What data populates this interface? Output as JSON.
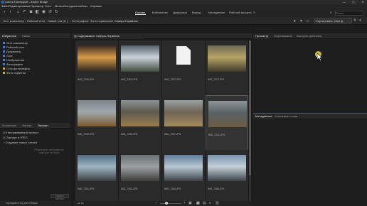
{
  "window": {
    "title": "Спена Гриппирай - Adobe Bridge",
    "minimize": "—",
    "maximize": "▢",
    "close": "✕"
  },
  "menu": [
    "Файл",
    "Редактирование",
    "Просмотр",
    "Стек",
    "Метки",
    "Инструменты",
    "Окно",
    "Справка"
  ],
  "workspaces": [
    {
      "label": "Основн.",
      "active": true
    },
    {
      "label": "Библиотеки",
      "active": false
    },
    {
      "label": "Диафильм",
      "active": false
    },
    {
      "label": "Вывод",
      "active": false
    },
    {
      "label": "Метаданные",
      "active": false
    },
    {
      "label": "Рабочий процесс",
      "active": false
    }
  ],
  "search_placeholder": "Поиск",
  "breadcrumbs": [
    "Этот компьютер",
    "Рабочий стол",
    "Новый том (D:)",
    "Фотографии",
    "Фото норвежские",
    "Северо-Норвегия"
  ],
  "sort": {
    "label": "Сортировать: Имя ф.",
    "menu": "▾"
  },
  "left_panel": {
    "tabs": [
      "Избранное",
      "Папки"
    ],
    "favorites": [
      {
        "label": "Этот компьютер",
        "color": "#4a79c6"
      },
      {
        "label": "Рабочий стол",
        "color": "#4a79c6"
      },
      {
        "label": "Документы",
        "color": "#4a79c6"
      },
      {
        "label": "Cont",
        "color": "#4a79c6"
      },
      {
        "label": "Изображения",
        "color": "#4a79c6"
      },
      {
        "label": "Фотографии",
        "color": "#4a79c6"
      },
      {
        "label": "Сток фотографии",
        "color": "#c9a84a"
      },
      {
        "label": "Фото норвегии",
        "color": "#c9a84a"
      }
    ],
    "lower_tabs": [
      "Коллекции",
      "Фильтр",
      "Экспорт"
    ],
    "export_items": [
      "Настраиваемый экспорт",
      "Экспорт в JPEG",
      "Создание новых стилей"
    ],
    "drop_hint": "Перетащите изображения сюда для экспорта",
    "start_button": "Начать экспорт"
  },
  "content": {
    "tab": "Содержимое: Северо-Норвегия",
    "items": [
      {
        "name": "IMG_7196.JPG",
        "kind": "photo",
        "palette": [
          "#3a2a24",
          "#d79a48",
          "#2b2620"
        ]
      },
      {
        "name": "IMG_7203.JPG",
        "kind": "photo",
        "palette": [
          "#55606a",
          "#c9d2d8",
          "#3f4b3e"
        ]
      },
      {
        "name": "IMG_7207.JPG",
        "kind": "file",
        "palette": [
          "#f2f2f2",
          "#ffffff",
          "#d0d0d0"
        ]
      },
      {
        "name": "IMG_7212.JPG",
        "kind": "photo",
        "palette": [
          "#6d6a55",
          "#b7a465",
          "#3e3b2b"
        ]
      },
      {
        "name": "IMG_7230.JPG",
        "kind": "photo",
        "palette": [
          "#7d858a",
          "#a0a8ad",
          "#7a5a2e"
        ]
      },
      {
        "name": "IMG_7233.JPG",
        "kind": "photo",
        "palette": [
          "#8b9296",
          "#5e5a4d",
          "#9b7d4e"
        ]
      },
      {
        "name": "IMG_7237.JPG",
        "kind": "photo",
        "palette": [
          "#9aa3a6",
          "#6f6456",
          "#a48a5a"
        ]
      },
      {
        "name": "IMG_7241.JPG",
        "kind": "photo",
        "palette": [
          "#8e969a",
          "#596266",
          "#6b5b42"
        ]
      },
      {
        "name": "IMG_7251.JPG",
        "kind": "photo",
        "palette": [
          "#4f6c82",
          "#9fb4c3",
          "#3a3f42"
        ]
      },
      {
        "name": "IMG_7253.JPG",
        "kind": "photo",
        "palette": [
          "#6a6f72",
          "#9ca1a4",
          "#3d3d3a"
        ]
      },
      {
        "name": "IMG_7254.JPG",
        "kind": "photo",
        "palette": [
          "#5e7d9a",
          "#b9c7d2",
          "#3c4347"
        ]
      },
      {
        "name": "IMG_7255.JPG",
        "kind": "photo",
        "palette": [
          "#7a95b0",
          "#c3cfd8",
          "#3a4246"
        ]
      }
    ],
    "status": "12 эл."
  },
  "right_panel": {
    "tabs": [
      "Просмотр",
      "Опубликовать",
      "Быстрые действия"
    ],
    "lower_tabs": [
      "Метаданные",
      "Ключевые слова"
    ]
  },
  "bottom_left": {
    "path": "Перекройте под контейнеры"
  }
}
